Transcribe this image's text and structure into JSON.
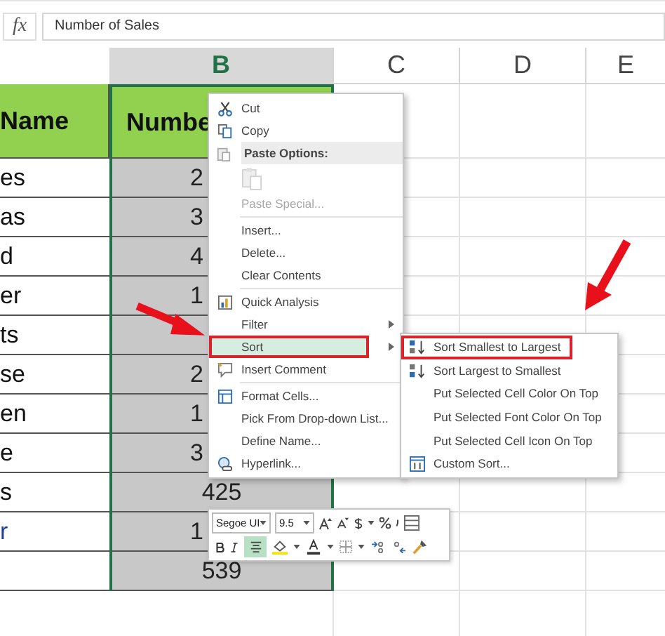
{
  "formula_bar": {
    "fx": "fx",
    "value": "Number of Sales"
  },
  "column_headers": [
    {
      "label": "B",
      "selected": true
    },
    {
      "label": "C",
      "selected": false
    },
    {
      "label": "D",
      "selected": false
    },
    {
      "label": "E",
      "selected": false
    }
  ],
  "rows": [
    {
      "kind": "header",
      "name": "Name",
      "value": "Numbe"
    },
    {
      "kind": "data",
      "name": "es",
      "value": "2"
    },
    {
      "kind": "data",
      "name": "as",
      "value": "3"
    },
    {
      "kind": "data",
      "name": "d",
      "value": "4"
    },
    {
      "kind": "data",
      "name": "er",
      "value": "1"
    },
    {
      "kind": "data",
      "name": "ts"
    },
    {
      "kind": "data",
      "name": "se",
      "value": "2"
    },
    {
      "kind": "data",
      "name": "en",
      "value": "1"
    },
    {
      "kind": "data",
      "name": "e",
      "value": "3"
    },
    {
      "kind": "data",
      "name": "s",
      "value": "425"
    },
    {
      "kind": "link",
      "name": "r",
      "value": "1"
    },
    {
      "kind": "data",
      "value": "539"
    }
  ],
  "context_menu": [
    {
      "kind": "item",
      "label": "Cut",
      "selected": false
    },
    {
      "kind": "item",
      "label": "Copy",
      "selected": false
    },
    {
      "kind": "heading",
      "label": "Paste Options:"
    },
    {
      "kind": "paste-icon",
      "disabled": true
    },
    {
      "kind": "item",
      "label": "Paste Special...",
      "disabled": true,
      "selected": false
    },
    {
      "kind": "separator"
    },
    {
      "kind": "item",
      "label": "Insert...",
      "selected": false
    },
    {
      "kind": "item",
      "label": "Delete...",
      "selected": false
    },
    {
      "kind": "item",
      "label": "Clear Contents",
      "selected": false
    },
    {
      "kind": "separator"
    },
    {
      "kind": "item",
      "label": "Quick Analysis",
      "selected": false
    },
    {
      "kind": "item",
      "label": "Filter",
      "submenu": true,
      "selected": false
    },
    {
      "kind": "item",
      "label": "Sort",
      "submenu": true,
      "selected": true,
      "outlined": true
    },
    {
      "kind": "item",
      "label": "Insert Comment",
      "selected": false
    },
    {
      "kind": "separator"
    },
    {
      "kind": "item",
      "label": "Format Cells...",
      "selected": false
    },
    {
      "kind": "item",
      "label": "Pick From Drop-down List...",
      "selected": false
    },
    {
      "kind": "item",
      "label": "Define Name...",
      "selected": false
    },
    {
      "kind": "item",
      "label": "Hyperlink...",
      "selected": false
    }
  ],
  "sort_submenu": [
    {
      "label": "Sort Smallest to Largest",
      "selected": false,
      "outlined": true
    },
    {
      "label": "Sort Largest to Smallest",
      "selected": false
    },
    {
      "label": "Put Selected Cell Color On Top",
      "selected": false
    },
    {
      "label": "Put Selected Font Color On Top",
      "selected": false
    },
    {
      "label": "Put Selected Cell Icon On Top",
      "selected": false
    },
    {
      "label": "Custom Sort...",
      "selected": false
    }
  ],
  "mini_toolbar": {
    "font": "Segoe UI",
    "size": "9.5",
    "center_selected": true
  }
}
